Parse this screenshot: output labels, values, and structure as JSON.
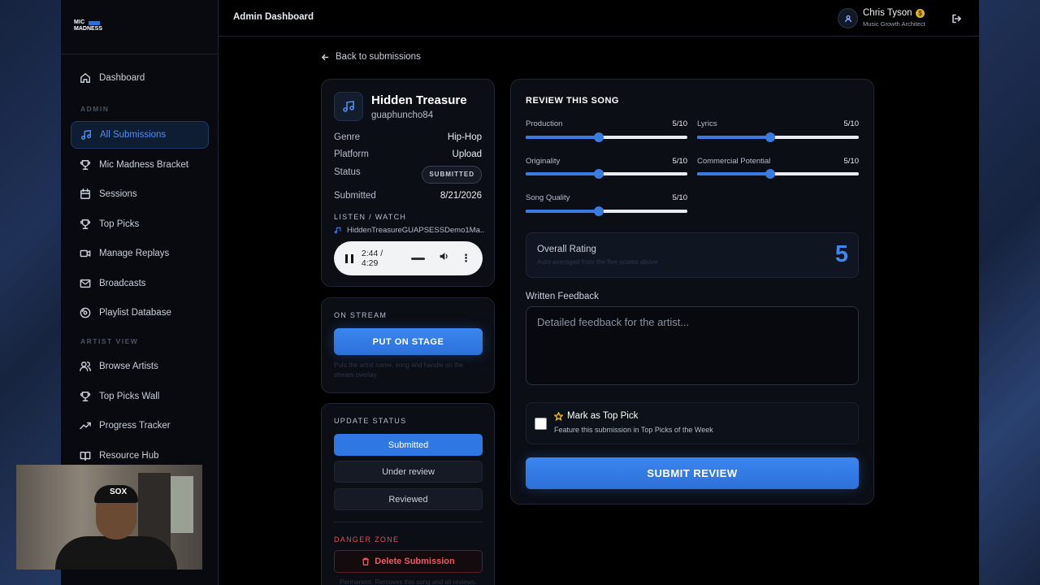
{
  "logo": {
    "line1": "MIC",
    "line2": "MADNESS"
  },
  "header": {
    "title": "Admin Dashboard",
    "user_name": "Chris Tyson",
    "user_role": "Music Growth Architect",
    "badge_icon": "gold-coin-icon"
  },
  "sidebar": {
    "sections": {
      "admin": "ADMIN",
      "artist_view": "ARTIST VIEW"
    },
    "items": [
      {
        "label": "Dashboard",
        "icon": "home-icon"
      },
      {
        "label": "All Submissions",
        "icon": "music-note-icon",
        "active": true
      },
      {
        "label": "Mic Madness Bracket",
        "icon": "trophy-icon"
      },
      {
        "label": "Sessions",
        "icon": "calendar-icon"
      },
      {
        "label": "Top Picks",
        "icon": "trophy-icon"
      },
      {
        "label": "Manage Replays",
        "icon": "video-icon"
      },
      {
        "label": "Broadcasts",
        "icon": "mail-icon"
      },
      {
        "label": "Playlist Database",
        "icon": "disc-icon"
      },
      {
        "label": "Browse Artists",
        "icon": "user-icon"
      },
      {
        "label": "Top Picks Wall",
        "icon": "trophy-icon"
      },
      {
        "label": "Progress Tracker",
        "icon": "trending-up-icon"
      },
      {
        "label": "Resource Hub",
        "icon": "book-icon"
      }
    ]
  },
  "main": {
    "back_label": "Back to submissions",
    "song": {
      "title": "Hidden Treasure",
      "artist": "guaphuncho84",
      "genre_label": "Genre",
      "genre": "Hip-Hop",
      "platform_label": "Platform",
      "platform": "Upload",
      "status_label": "Status",
      "status": "SUBMITTED",
      "submitted_label": "Submitted",
      "submitted": "8/21/2026",
      "listen_label": "LISTEN / WATCH",
      "file_name": "HiddenTreasureGUAPSESSDemo1Ma..."
    },
    "audio": {
      "time": "2:44 / 4:29",
      "progress": 0.61
    },
    "stream": {
      "label": "ON STREAM",
      "button": "PUT ON STAGE",
      "hint": "Puts the artist name, song and handle on the stream overlay."
    },
    "status_update": {
      "label": "UPDATE STATUS",
      "options": [
        "Submitted",
        "Under review",
        "Reviewed"
      ],
      "selected": "Submitted"
    },
    "danger": {
      "label": "DANGER ZONE",
      "button": "Delete Submission",
      "hint": "Permanent. Removes this song and all reviews."
    },
    "review": {
      "title": "REVIEW THIS SONG",
      "criteria": [
        {
          "label": "Production",
          "value": "5/10",
          "score": 5
        },
        {
          "label": "Lyrics",
          "value": "5/10",
          "score": 5
        },
        {
          "label": "Originality",
          "value": "5/10",
          "score": 5
        },
        {
          "label": "Commercial Potential",
          "value": "5/10",
          "score": 5
        },
        {
          "label": "Song Quality",
          "value": "5/10",
          "score": 5
        }
      ],
      "overall_label": "Overall Rating",
      "overall_sub": "Auto-averaged from the five scores above",
      "overall_value": "5",
      "feedback_label": "Written Feedback",
      "feedback_placeholder": "Detailed feedback for the artist...",
      "top_pick_label": "Mark as Top Pick",
      "top_pick_sub": "Feature this submission in Top Picks of the Week",
      "submit_label": "SUBMIT REVIEW"
    }
  },
  "webcam": {
    "cap_logo": "SOX"
  },
  "colors": {
    "accent": "#3b86f0",
    "danger": "#ee5a64",
    "gold": "#e3b414"
  }
}
